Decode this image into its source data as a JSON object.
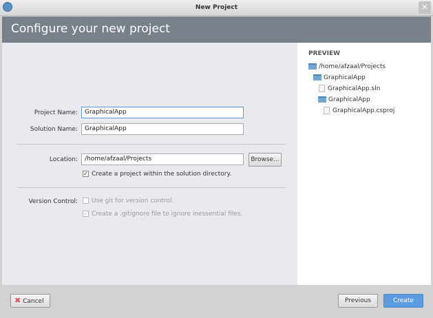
{
  "window": {
    "title": "New Project"
  },
  "header": {
    "title": "Configure your new project"
  },
  "form": {
    "project_name_label": "Project Name:",
    "project_name_value": "GraphicalApp",
    "solution_name_label": "Solution Name:",
    "solution_name_value": "GraphicalApp",
    "location_label": "Location:",
    "location_value": "/home/afzaal/Projects",
    "browse_label": "Browse...",
    "create_within_label": "Create a project within the solution directory.",
    "version_control_label": "Version Control:",
    "use_git_label": "Use git for version control.",
    "gitignore_label": "Create a .gitignore file to ignore inessential files."
  },
  "preview": {
    "title": "PREVIEW",
    "items": [
      {
        "label": "/home/afzaal/Projects",
        "type": "folder"
      },
      {
        "label": "GraphicalApp",
        "type": "folder"
      },
      {
        "label": "GraphicalApp.sln",
        "type": "file"
      },
      {
        "label": "GraphicalApp",
        "type": "folder"
      },
      {
        "label": "GraphicalApp.csproj",
        "type": "file"
      }
    ]
  },
  "footer": {
    "cancel": "Cancel",
    "previous": "Previous",
    "create": "Create"
  },
  "colors": {
    "accent": "#5b9be0",
    "header": "#788089"
  }
}
